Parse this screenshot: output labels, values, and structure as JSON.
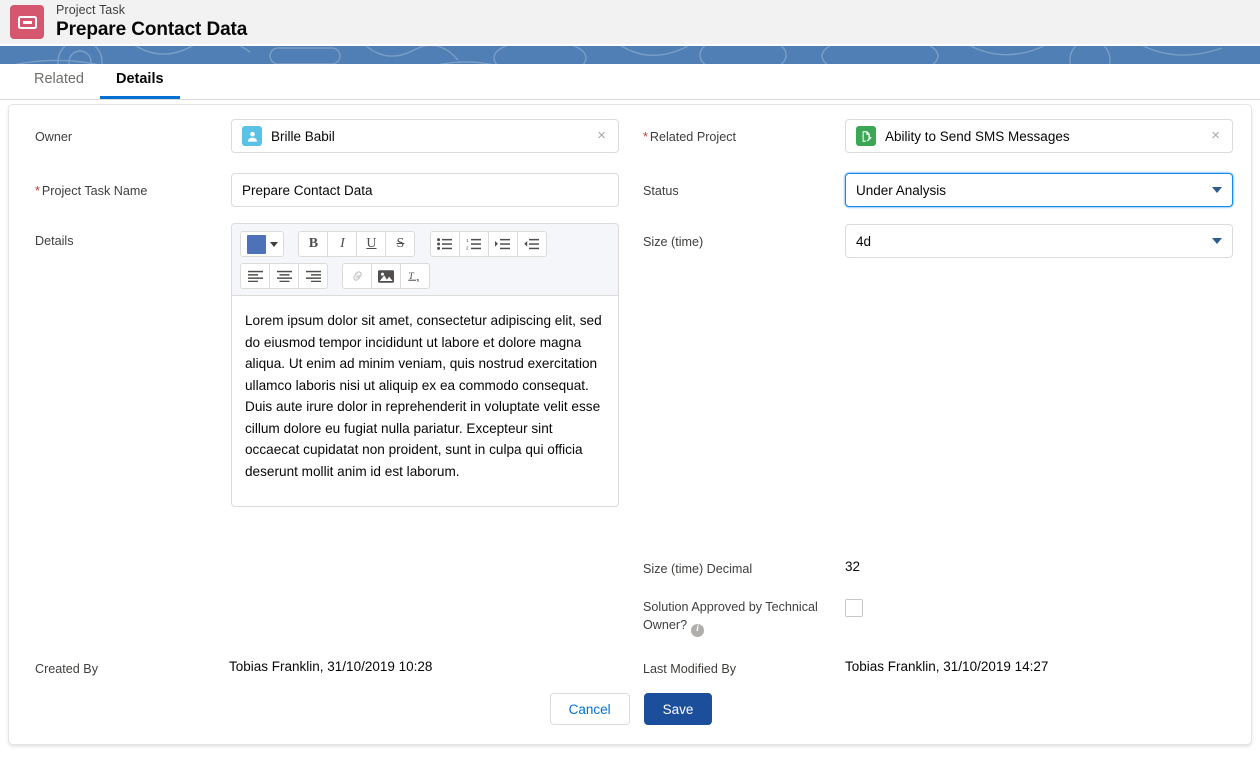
{
  "header": {
    "object_label": "Project Task",
    "record_title": "Prepare Contact Data",
    "icon": "task-ticket-icon",
    "icon_color": "#d4566f"
  },
  "tabs": [
    {
      "label": "Related",
      "active": false
    },
    {
      "label": "Details",
      "active": true
    }
  ],
  "form": {
    "left": {
      "owner": {
        "label": "Owner",
        "required": false,
        "value": "Brille Babil",
        "icon": "user-avatar-icon",
        "icon_color": "#5bc2e7",
        "clear": "×"
      },
      "project_task_name": {
        "label": "Project Task Name",
        "required": true,
        "value": "Prepare Contact Data",
        "placeholder": ""
      },
      "details": {
        "label": "Details",
        "required": false,
        "body": "Lorem ipsum dolor sit amet, consectetur adipiscing elit, sed do eiusmod tempor incididunt ut labore et dolore magna aliqua. Ut enim ad minim veniam, quis nostrud exercitation ullamco laboris nisi ut aliquip ex ea commodo consequat. Duis aute irure dolor in reprehenderit in voluptate velit esse cillum dolore eu fugiat nulla pariatur. Excepteur sint occaecat cupidatat non proident, sunt in culpa qui officia deserunt mollit anim id est laborum.",
        "toolbar": {
          "color_swatch": "#4d72b8",
          "buttons": [
            {
              "name": "text-color-picker",
              "glyph": "",
              "type": "color"
            },
            {
              "name": "bold",
              "glyph": "B"
            },
            {
              "name": "italic",
              "glyph": "I"
            },
            {
              "name": "underline",
              "glyph": "U"
            },
            {
              "name": "strikethrough",
              "glyph": "S"
            },
            {
              "name": "bulleted-list",
              "glyph": "list"
            },
            {
              "name": "numbered-list",
              "glyph": "olist"
            },
            {
              "name": "indent",
              "glyph": "indent"
            },
            {
              "name": "outdent",
              "glyph": "outdent"
            },
            {
              "name": "align-left",
              "glyph": "alignleft"
            },
            {
              "name": "align-center",
              "glyph": "aligncenter"
            },
            {
              "name": "align-right",
              "glyph": "alignright"
            },
            {
              "name": "link",
              "glyph": "link",
              "disabled": true
            },
            {
              "name": "image",
              "glyph": "image"
            },
            {
              "name": "remove-formatting",
              "glyph": "Tx"
            }
          ]
        }
      },
      "created_by": {
        "label": "Created By",
        "value": "Tobias Franklin, 31/10/2019 10:28"
      }
    },
    "right": {
      "related_project": {
        "label": "Related Project",
        "required": true,
        "value": "Ability to Send SMS Messages",
        "icon": "document-record-icon",
        "icon_color": "#3ba755",
        "clear": "×"
      },
      "status": {
        "label": "Status",
        "required": false,
        "value": "Under Analysis",
        "focused": true,
        "options": [
          "Under Analysis"
        ]
      },
      "size_time": {
        "label": "Size (time)",
        "required": false,
        "value": "4d",
        "options": [
          "4d"
        ]
      },
      "size_time_decimal": {
        "label": "Size (time) Decimal",
        "value": "32"
      },
      "solution_approved": {
        "label": "Solution Approved by Technical Owner?",
        "checked": false,
        "help_icon": "info-icon",
        "help_glyph": "i"
      },
      "last_modified_by": {
        "label": "Last Modified By",
        "value": "Tobias Franklin, 31/10/2019 14:27"
      }
    }
  },
  "footer": {
    "cancel_label": "Cancel",
    "save_label": "Save"
  },
  "colors": {
    "accent_blue": "#0070d2",
    "brand_button": "#1b4f9c",
    "focus_blue": "#1589ee",
    "required_red": "#c23934",
    "strip_blue": "#4f7fb5"
  }
}
